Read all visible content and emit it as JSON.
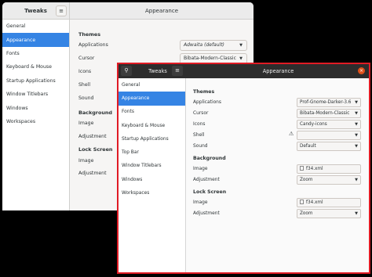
{
  "back": {
    "sidebar_title": "Tweaks",
    "main_title": "Appearance",
    "menu_icon": "hamburger-menu-icon",
    "sidebar_items": [
      "General",
      "Appearance",
      "Fonts",
      "Keyboard & Mouse",
      "Startup Applications",
      "Window Titlebars",
      "Windows",
      "Workspaces"
    ],
    "selected_index": 1,
    "sections": {
      "themes": "Themes",
      "background": "Background",
      "lock_screen": "Lock Screen"
    },
    "labels": {
      "applications": "Applications",
      "cursor": "Cursor",
      "icons": "Icons",
      "shell": "Shell",
      "sound": "Sound",
      "bg_image": "Image",
      "bg_adjustment": "Adjustment",
      "ls_image": "Image",
      "ls_adjustment": "Adjustment"
    },
    "values": {
      "applications": "Adwaita (default)",
      "cursor": "Bibata-Modern-Classic"
    }
  },
  "front": {
    "sidebar_title": "Tweaks",
    "main_title": "Appearance",
    "search_icon": "search-icon",
    "menu_icon": "hamburger-menu-icon",
    "close_icon": "close-icon",
    "close_glyph": "×",
    "sidebar_items": [
      "General",
      "Appearance",
      "Fonts",
      "Keyboard & Mouse",
      "Startup Applications",
      "Top Bar",
      "Window Titlebars",
      "Windows",
      "Workspaces"
    ],
    "selected_index": 1,
    "sections": {
      "themes": "Themes",
      "background": "Background",
      "lock_screen": "Lock Screen"
    },
    "labels": {
      "applications": "Applications",
      "cursor": "Cursor",
      "icons": "Icons",
      "shell": "Shell",
      "sound": "Sound",
      "bg_image": "Image",
      "bg_adjustment": "Adjustment",
      "ls_image": "Image",
      "ls_adjustment": "Adjustment"
    },
    "values": {
      "applications": "Prof-Gnome-Darker-3.6",
      "cursor": "Bibata-Modern-Classic",
      "icons": "Candy-icons",
      "shell": "",
      "sound": "Default",
      "bg_image": "f34.xml",
      "bg_adjustment": "Zoom",
      "ls_image": "f34.xml",
      "ls_adjustment": "Zoom"
    },
    "shell_warning_icon": "warning-icon",
    "accent": "#3584e4",
    "border_highlight": "#e01b24"
  }
}
